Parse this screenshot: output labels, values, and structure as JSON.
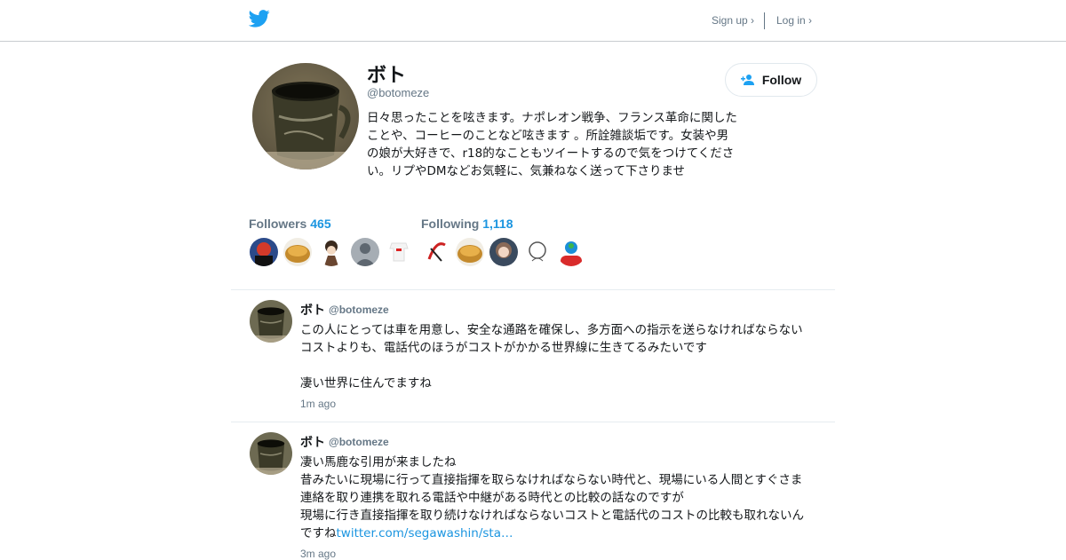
{
  "nav": {
    "signup": "Sign up ›",
    "login": "Log in ›"
  },
  "profile": {
    "name": "ボト",
    "handle": "@botomeze",
    "bio": "日々思ったことを呟きます。ナポレオン戦争、フランス革命に関したことや、コーヒーのことなど呟きます 。所詮雑談垢です。女装や男の娘が大好きで、r18的なこともツイートするので気をつけてください。リプやDMなどお気軽に、気兼ねなく送って下さりませ",
    "follow_label": "Follow"
  },
  "stats": {
    "followers_label": "Followers",
    "followers_count": "465",
    "following_label": "Following",
    "following_count": "1,118"
  },
  "tweets": [
    {
      "name": "ボト",
      "handle": "@botomeze",
      "lines": [
        "この人にとっては車を用意し、安全な通路を確保し、多方面への指示を送らなければならない",
        "コストよりも、電話代のほうがコストがかかる世界線に生きてるみたいです",
        "",
        "凄い世界に住んでますね"
      ],
      "time": "1m ago"
    },
    {
      "name": "ボト",
      "handle": "@botomeze",
      "lines": [
        "凄い馬鹿な引用が来ましたね",
        "昔みたいに現場に行って直接指揮を取らなければならない時代と、現場にいる人間とすぐさま",
        "連絡を取り連携を取れる電話や中継がある時代との比較の話なのですが",
        "現場に行き直接指揮を取り続けなければならないコストと電話代のコストの比較も取れないん"
      ],
      "last_line_text": "ですね",
      "link": "twitter.com/segawashin/sta…",
      "time": "3m ago"
    }
  ],
  "colors": {
    "accent": "#1b95e0",
    "twitter_blue": "#1da1f2",
    "muted": "#657786"
  },
  "icons": [
    "twitter-bird-icon",
    "add-person-icon"
  ]
}
